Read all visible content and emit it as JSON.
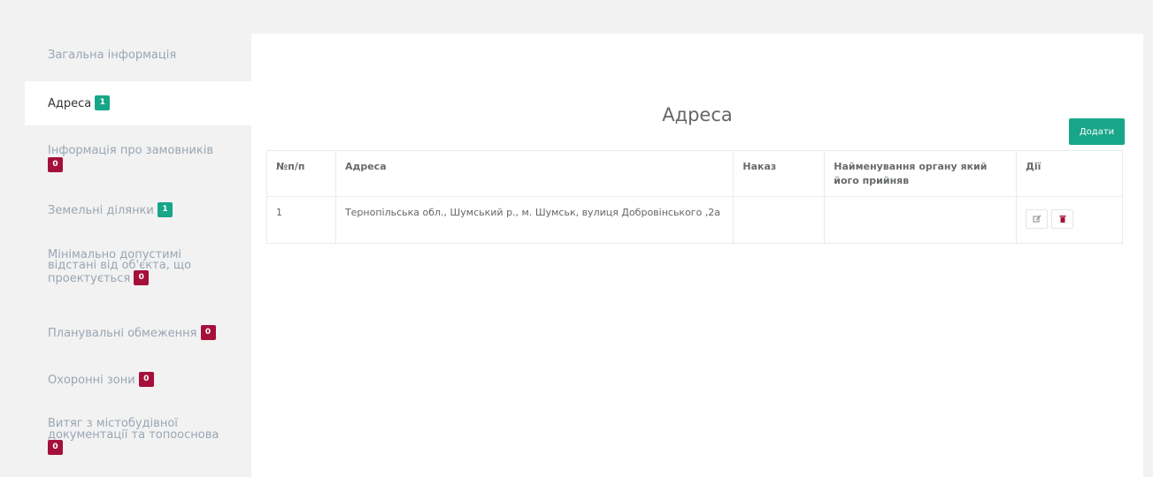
{
  "sidebar": {
    "items": [
      {
        "label": "Загальна інформація",
        "badge": null
      },
      {
        "label": "Адреса",
        "badge": "1",
        "badge_color": "#18a689"
      },
      {
        "label": "Інформація про замовників",
        "badge": "0",
        "badge_color": "#a5103a"
      },
      {
        "label": "Земельні ділянки",
        "badge": "1",
        "badge_color": "#18a689"
      },
      {
        "label": "Мінімально допустимі відстані від об'єкта, що проектується",
        "badge": "0",
        "badge_color": "#a5103a"
      },
      {
        "label": "Планувальні обмеження",
        "badge": "0",
        "badge_color": "#a5103a"
      },
      {
        "label": "Охоронні зони",
        "badge": "0",
        "badge_color": "#a5103a"
      },
      {
        "label": "Витяг з містобудівної документації та топооснова",
        "badge": "0",
        "badge_color": "#a5103a"
      }
    ],
    "active_index": 1
  },
  "main": {
    "title": "Адреса",
    "add_button": "Додати",
    "table": {
      "headers": [
        "№п/п",
        "Адреса",
        "Наказ",
        "Найменування органу який його прийняв",
        "Дії"
      ],
      "rows": [
        {
          "number": "1",
          "address": "Тернопільська обл., Шумський р., м. Шумськ, вулиця Добровінського ,2а",
          "order": "",
          "authority": "",
          "actions": [
            "edit-icon",
            "trash-icon"
          ]
        }
      ]
    }
  },
  "colors": {
    "accent": "#18a689",
    "danger": "#a5103a",
    "background": "#f2f2f2"
  }
}
